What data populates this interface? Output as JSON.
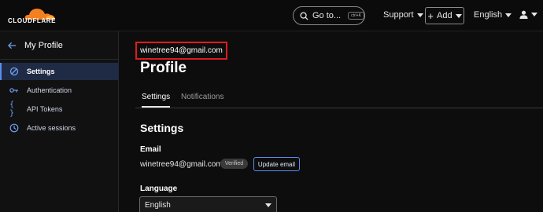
{
  "header": {
    "brand": "CLOUDFLARE",
    "goto_label": "Go to...",
    "goto_shortcut": "ctrl+K",
    "support_label": "Support",
    "add_label": "Add",
    "language_label": "English",
    "accent_color": "#f38020"
  },
  "sidebar": {
    "title": "My Profile",
    "items": [
      {
        "label": "Settings",
        "icon": "sliders-icon",
        "active": true
      },
      {
        "label": "Authentication",
        "icon": "key-icon",
        "active": false
      },
      {
        "label": "API Tokens",
        "icon": "braces-icon",
        "active": false
      },
      {
        "label": "Active sessions",
        "icon": "clock-icon",
        "active": false
      }
    ]
  },
  "main": {
    "email_highlight": "winetree94@gmail.com",
    "title": "Profile",
    "tabs": [
      {
        "label": "Settings",
        "active": true
      },
      {
        "label": "Notifications",
        "active": false
      }
    ],
    "section_title": "Settings",
    "email_label": "Email",
    "email_value": "winetree94@gmail.com",
    "verified_badge": "Verified",
    "update_email_label": "Update email",
    "language_label": "Language",
    "language_value": "English"
  }
}
